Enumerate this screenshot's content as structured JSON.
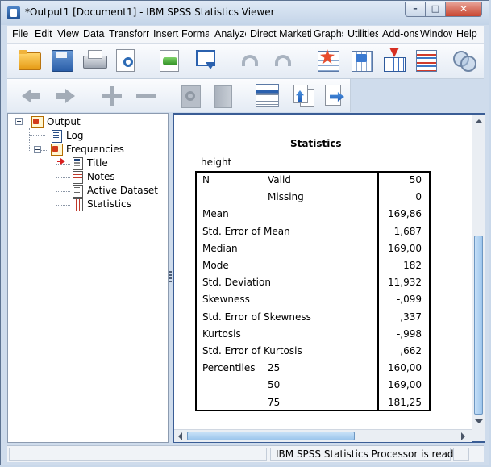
{
  "window": {
    "title": "*Output1 [Document1] - IBM SPSS Statistics Viewer",
    "minimize_glyph": "–",
    "maximize_glyph": "□",
    "close_glyph": "✕"
  },
  "menu": [
    "File",
    "Edit",
    "View",
    "Data",
    "Transform",
    "Insert",
    "Format",
    "Analyze",
    "Direct Marketing",
    "Graphs",
    "Utilities",
    "Add-ons",
    "Window",
    "Help"
  ],
  "toolbar_icons": [
    "folder-open-icon",
    "save-icon",
    "print-icon",
    "print-preview-icon",
    "export-icon",
    "recall-dialog-icon",
    "undo-icon",
    "redo-icon",
    "go-to-data-icon",
    "go-to-case-icon",
    "go-to-variable-icon",
    "variables-icon",
    "use-sets-icon",
    "back-arrow-icon",
    "forward-arrow-icon",
    "expand-icon",
    "collapse-icon",
    "show-icon",
    "hide-icon",
    "designate-window-icon",
    "promote-icon",
    "demote-icon"
  ],
  "outline": {
    "root": "Output",
    "log": "Log",
    "frequencies": "Frequencies",
    "title": "Title",
    "notes": "Notes",
    "active_dataset": "Active Dataset",
    "statistics": "Statistics"
  },
  "statistics_table": {
    "title": "Statistics",
    "variable": "height",
    "rows": [
      {
        "label": "N",
        "sub": "Valid",
        "value": "50"
      },
      {
        "label": "",
        "sub": "Missing",
        "value": "0"
      },
      {
        "label": "Mean",
        "sub": "",
        "value": "169,86"
      },
      {
        "label": "Std. Error of Mean",
        "sub": "",
        "value": "1,687"
      },
      {
        "label": "Median",
        "sub": "",
        "value": "169,00"
      },
      {
        "label": "Mode",
        "sub": "",
        "value": "182"
      },
      {
        "label": "Std. Deviation",
        "sub": "",
        "value": "11,932"
      },
      {
        "label": "Skewness",
        "sub": "",
        "value": "-,099"
      },
      {
        "label": "Std. Error of Skewness",
        "sub": "",
        "value": ",337"
      },
      {
        "label": "Kurtosis",
        "sub": "",
        "value": "-,998"
      },
      {
        "label": "Std. Error of Kurtosis",
        "sub": "",
        "value": ",662"
      },
      {
        "label": "Percentiles",
        "sub": "25",
        "value": "160,00"
      },
      {
        "label": "",
        "sub": "50",
        "value": "169,00"
      },
      {
        "label": "",
        "sub": "75",
        "value": "181,25"
      }
    ]
  },
  "status": {
    "processor": "IBM SPSS Statistics Processor is ready"
  }
}
